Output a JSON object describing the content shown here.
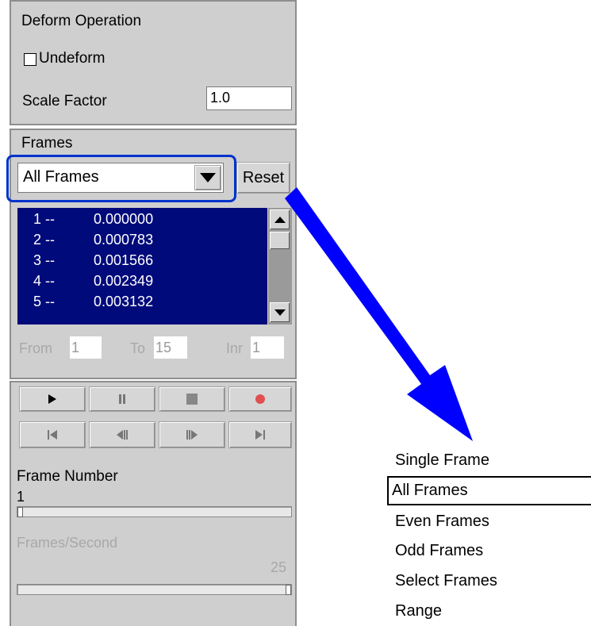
{
  "deform": {
    "title": "Deform Operation",
    "undeform_label": "Undeform",
    "undeform_checked": false,
    "scale_label": "Scale Factor",
    "scale_value": "1.0"
  },
  "frames": {
    "title": "Frames",
    "mode_value": "All Frames",
    "reset_label": "Reset",
    "list": [
      {
        "index": "1 --",
        "value": "0.000000"
      },
      {
        "index": "2 --",
        "value": "0.000783"
      },
      {
        "index": "3 --",
        "value": "0.001566"
      },
      {
        "index": "4 --",
        "value": "0.002349"
      },
      {
        "index": "5 --",
        "value": "0.003132"
      }
    ],
    "from_label": "From",
    "from_value": "1",
    "to_label": "To",
    "to_value": "15",
    "inr_label": "Inr",
    "inr_value": "1"
  },
  "playback": {
    "buttons_row1": [
      "play-icon",
      "pause-icon",
      "stop-icon",
      "record-icon"
    ],
    "buttons_row2": [
      "first-frame-icon",
      "step-back-icon",
      "step-forward-icon",
      "last-frame-icon"
    ],
    "record_color": "#e05050",
    "frame_number_label": "Frame Number",
    "frame_number_value": "1",
    "frame_slider_fraction": 0,
    "fps_label": "Frames/Second",
    "fps_value": "25",
    "fps_slider_fraction": 1
  },
  "highlight_color": "#0033cc",
  "arrow_color": "#0000ff",
  "dropdown_popup": {
    "items": [
      "Single Frame",
      "All Frames",
      "Even Frames",
      "Odd Frames",
      "Select Frames",
      "Range"
    ],
    "selected_index": 1
  }
}
